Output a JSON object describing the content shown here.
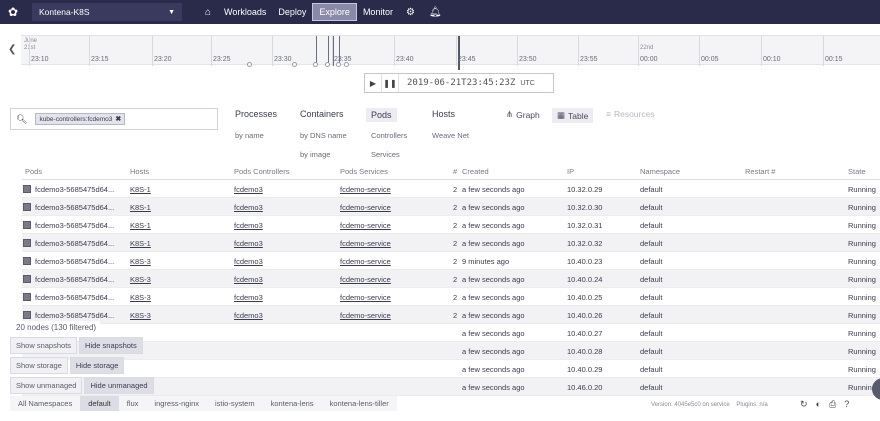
{
  "topbar": {
    "cluster": "Kontena-K8S",
    "nav": [
      "Workloads",
      "Deploy",
      "Explore",
      "Monitor"
    ],
    "active_nav": "Explore"
  },
  "timeline": {
    "date_start": "June",
    "day_start": "21st",
    "day_next": "22nd",
    "ticks": [
      "23:10",
      "23:15",
      "23:20",
      "23:25",
      "23:30",
      "23:35",
      "23:40",
      "23:45",
      "23:50",
      "23:55",
      "00:00",
      "00:05",
      "00:10",
      "00:15"
    ],
    "timestamp": "2019-06-21T23:45:23Z",
    "timezone": "UTC"
  },
  "search": {
    "tag": "kube-controllers:fcdemo3"
  },
  "topologies": [
    {
      "label": "Processes",
      "subs": [
        "by name"
      ]
    },
    {
      "label": "Containers",
      "subs": [
        "by DNS name",
        "by image"
      ]
    },
    {
      "label": "Pods",
      "subs": [
        "Controllers",
        "Services"
      ]
    },
    {
      "label": "Hosts",
      "subs": [
        "Weave Net"
      ]
    }
  ],
  "views": {
    "graph": "Graph",
    "table": "Table",
    "resources": "Resources"
  },
  "table": {
    "headers": [
      "Pods",
      "Hosts",
      "Pods Controllers",
      "Pods Services",
      "#",
      "Created",
      "IP",
      "Namespace",
      "Restart #",
      "State"
    ],
    "rows": [
      [
        "fcdemo3-5685475d64...",
        "K8S-1",
        "fcdemo3",
        "fcdemo-service",
        "2",
        "a few seconds ago",
        "10.32.0.29",
        "default",
        "",
        "Running"
      ],
      [
        "fcdemo3-5685475d64...",
        "K8S-1",
        "fcdemo3",
        "fcdemo-service",
        "2",
        "a few seconds ago",
        "10.32.0.30",
        "default",
        "",
        "Running"
      ],
      [
        "fcdemo3-5685475d64...",
        "K8S-1",
        "fcdemo3",
        "fcdemo-service",
        "2",
        "a few seconds ago",
        "10.32.0.31",
        "default",
        "",
        "Running"
      ],
      [
        "fcdemo3-5685475d64...",
        "K8S-1",
        "fcdemo3",
        "fcdemo-service",
        "2",
        "a few seconds ago",
        "10.32.0.32",
        "default",
        "",
        "Running"
      ],
      [
        "fcdemo3-5685475d64...",
        "K8S-3",
        "fcdemo3",
        "fcdemo-service",
        "2",
        "9 minutes ago",
        "10.40.0.23",
        "default",
        "",
        "Running"
      ],
      [
        "fcdemo3-5685475d64...",
        "K8S-3",
        "fcdemo3",
        "fcdemo-service",
        "2",
        "a few seconds ago",
        "10.40.0.24",
        "default",
        "",
        "Running"
      ],
      [
        "fcdemo3-5685475d64...",
        "K8S-3",
        "fcdemo3",
        "fcdemo-service",
        "2",
        "a few seconds ago",
        "10.40.0.25",
        "default",
        "",
        "Running"
      ],
      [
        "fcdemo3-5685475d64...",
        "K8S-3",
        "fcdemo3",
        "fcdemo-service",
        "2",
        "a few seconds ago",
        "10.40.0.26",
        "default",
        "",
        "Running"
      ],
      [
        "",
        "",
        "",
        "",
        "",
        "a few seconds ago",
        "10.40.0.27",
        "default",
        "",
        "Running"
      ],
      [
        "",
        "",
        "",
        "",
        "",
        "a few seconds ago",
        "10.40.0.28",
        "default",
        "",
        "Running"
      ],
      [
        "",
        "",
        "",
        "",
        "",
        "a few seconds ago",
        "10.40.0.29",
        "default",
        "",
        "Running"
      ],
      [
        "",
        "",
        "",
        "",
        "",
        "a few seconds ago",
        "10.46.0.20",
        "default",
        "",
        "Running"
      ]
    ]
  },
  "status": {
    "count": "20 nodes (130 filtered)",
    "options": [
      {
        "show": "Show snapshots",
        "hide": "Hide snapshots"
      },
      {
        "show": "Show storage",
        "hide": "Hide storage"
      },
      {
        "show": "Show unmanaged",
        "hide": "Hide unmanaged"
      }
    ]
  },
  "namespaces": [
    "All Namespaces",
    "default",
    "flux",
    "ingress-nginx",
    "istio-system",
    "kontena-lens",
    "kontena-lens-tiller"
  ],
  "selected_namespace": "default",
  "footer": {
    "version": "Version: 4045e5c0 on service",
    "plugins": "Plugins: n/a"
  }
}
